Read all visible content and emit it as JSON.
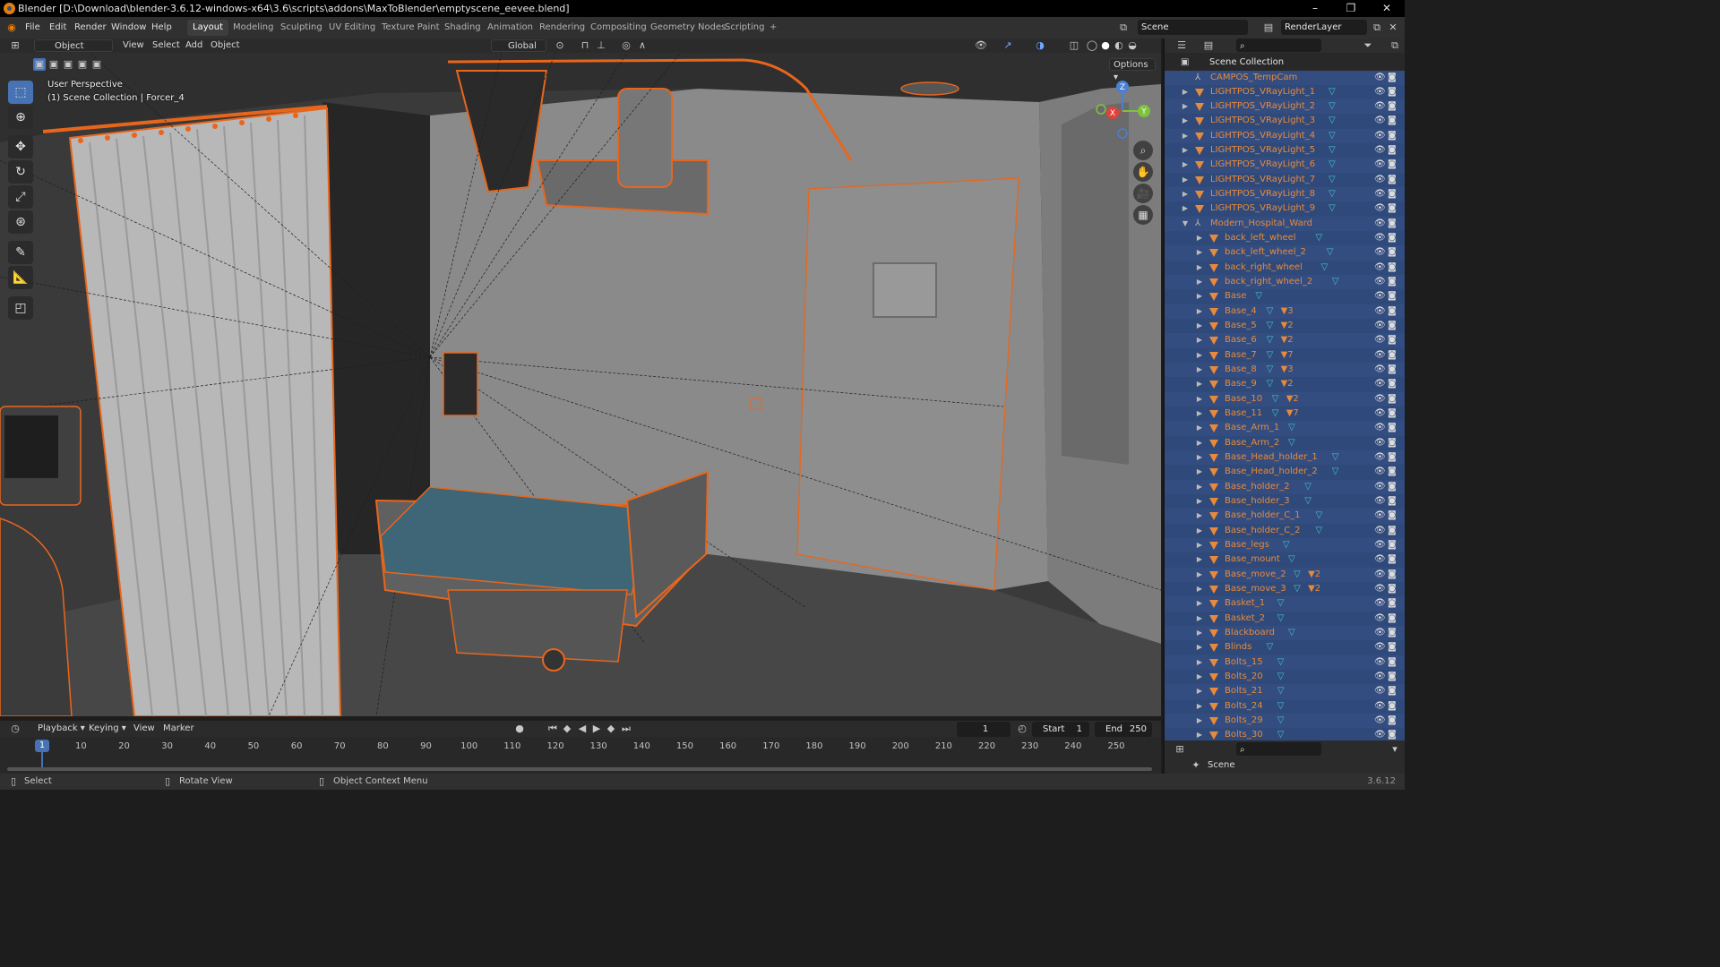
{
  "window": {
    "title": "Blender [D:\\Download\\blender-3.6.12-windows-x64\\3.6\\scripts\\addons\\MaxToBlender\\emptyscene_eevee.blend]",
    "controls": [
      "–",
      "❐",
      "✕"
    ]
  },
  "menubar": {
    "menus": [
      "File",
      "Edit",
      "Render",
      "Window",
      "Help"
    ],
    "workspaces": [
      "Layout",
      "Modeling",
      "Sculpting",
      "UV Editing",
      "Texture Paint",
      "Shading",
      "Animation",
      "Rendering",
      "Compositing",
      "Geometry Nodes",
      "Scripting"
    ],
    "active_workspace": "Layout",
    "add_tab": "+",
    "scene": "Scene",
    "view_layer": "RenderLayer"
  },
  "viewport_header": {
    "mode": "Object Mode",
    "menus": [
      "View",
      "Select",
      "Add",
      "Object"
    ],
    "transform_orientation": "Global",
    "options": "Options"
  },
  "viewport": {
    "perspective_label": "User Perspective",
    "context_label": "(1) Scene Collection | Forcer_4",
    "gizmo_axes": [
      "X",
      "Y",
      "Z"
    ]
  },
  "toolbar": {
    "tools": [
      "select-box",
      "cursor",
      "move",
      "rotate",
      "scale",
      "transform",
      "annotate",
      "measure",
      "add-cube"
    ]
  },
  "outliner": {
    "root": "Scene Collection",
    "items": [
      {
        "name": "CAMPOS_TempCam",
        "level": 0,
        "kind": "empty",
        "expand": false,
        "mesh": false,
        "mods": ""
      },
      {
        "name": "LIGHTPOS_VRayLight_1",
        "level": 0,
        "kind": "object",
        "expand": true,
        "mesh": true,
        "mods": ""
      },
      {
        "name": "LIGHTPOS_VRayLight_2",
        "level": 0,
        "kind": "object",
        "expand": true,
        "mesh": true,
        "mods": ""
      },
      {
        "name": "LIGHTPOS_VRayLight_3",
        "level": 0,
        "kind": "object",
        "expand": true,
        "mesh": true,
        "mods": ""
      },
      {
        "name": "LIGHTPOS_VRayLight_4",
        "level": 0,
        "kind": "object",
        "expand": true,
        "mesh": true,
        "mods": ""
      },
      {
        "name": "LIGHTPOS_VRayLight_5",
        "level": 0,
        "kind": "object",
        "expand": true,
        "mesh": true,
        "mods": ""
      },
      {
        "name": "LIGHTPOS_VRayLight_6",
        "level": 0,
        "kind": "object",
        "expand": true,
        "mesh": true,
        "mods": ""
      },
      {
        "name": "LIGHTPOS_VRayLight_7",
        "level": 0,
        "kind": "object",
        "expand": true,
        "mesh": true,
        "mods": ""
      },
      {
        "name": "LIGHTPOS_VRayLight_8",
        "level": 0,
        "kind": "object",
        "expand": true,
        "mesh": true,
        "mods": ""
      },
      {
        "name": "LIGHTPOS_VRayLight_9",
        "level": 0,
        "kind": "object",
        "expand": true,
        "mesh": true,
        "mods": ""
      },
      {
        "name": "Modern_Hospital_Ward",
        "level": 0,
        "kind": "empty",
        "expand": "open",
        "mesh": false,
        "mods": ""
      },
      {
        "name": "back_left_wheel",
        "level": 1,
        "kind": "object",
        "expand": true,
        "mesh": true,
        "mods": ""
      },
      {
        "name": "back_left_wheel_2",
        "level": 1,
        "kind": "object",
        "expand": true,
        "mesh": true,
        "mods": ""
      },
      {
        "name": "back_right_wheel",
        "level": 1,
        "kind": "object",
        "expand": true,
        "mesh": true,
        "mods": ""
      },
      {
        "name": "back_right_wheel_2",
        "level": 1,
        "kind": "object",
        "expand": true,
        "mesh": true,
        "mods": ""
      },
      {
        "name": "Base",
        "level": 1,
        "kind": "object",
        "expand": true,
        "mesh": true,
        "mods": ""
      },
      {
        "name": "Base_4",
        "level": 1,
        "kind": "object",
        "expand": true,
        "mesh": true,
        "mods": "3"
      },
      {
        "name": "Base_5",
        "level": 1,
        "kind": "object",
        "expand": true,
        "mesh": true,
        "mods": "2"
      },
      {
        "name": "Base_6",
        "level": 1,
        "kind": "object",
        "expand": true,
        "mesh": true,
        "mods": "2"
      },
      {
        "name": "Base_7",
        "level": 1,
        "kind": "object",
        "expand": true,
        "mesh": true,
        "mods": "7"
      },
      {
        "name": "Base_8",
        "level": 1,
        "kind": "object",
        "expand": true,
        "mesh": true,
        "mods": "3"
      },
      {
        "name": "Base_9",
        "level": 1,
        "kind": "object",
        "expand": true,
        "mesh": true,
        "mods": "2"
      },
      {
        "name": "Base_10",
        "level": 1,
        "kind": "object",
        "expand": true,
        "mesh": true,
        "mods": "2"
      },
      {
        "name": "Base_11",
        "level": 1,
        "kind": "object",
        "expand": true,
        "mesh": true,
        "mods": "7"
      },
      {
        "name": "Base_Arm_1",
        "level": 1,
        "kind": "object",
        "expand": true,
        "mesh": true,
        "mods": ""
      },
      {
        "name": "Base_Arm_2",
        "level": 1,
        "kind": "object",
        "expand": true,
        "mesh": true,
        "mods": ""
      },
      {
        "name": "Base_Head_holder_1",
        "level": 1,
        "kind": "object",
        "expand": true,
        "mesh": true,
        "mods": ""
      },
      {
        "name": "Base_Head_holder_2",
        "level": 1,
        "kind": "object",
        "expand": true,
        "mesh": true,
        "mods": ""
      },
      {
        "name": "Base_holder_2",
        "level": 1,
        "kind": "object",
        "expand": true,
        "mesh": true,
        "mods": ""
      },
      {
        "name": "Base_holder_3",
        "level": 1,
        "kind": "object",
        "expand": true,
        "mesh": true,
        "mods": ""
      },
      {
        "name": "Base_holder_C_1",
        "level": 1,
        "kind": "object",
        "expand": true,
        "mesh": true,
        "mods": ""
      },
      {
        "name": "Base_holder_C_2",
        "level": 1,
        "kind": "object",
        "expand": true,
        "mesh": true,
        "mods": ""
      },
      {
        "name": "Base_legs",
        "level": 1,
        "kind": "object",
        "expand": true,
        "mesh": true,
        "mods": ""
      },
      {
        "name": "Base_mount",
        "level": 1,
        "kind": "object",
        "expand": true,
        "mesh": true,
        "mods": ""
      },
      {
        "name": "Base_move_2",
        "level": 1,
        "kind": "object",
        "expand": true,
        "mesh": true,
        "mods": "2"
      },
      {
        "name": "Base_move_3",
        "level": 1,
        "kind": "object",
        "expand": true,
        "mesh": true,
        "mods": "2"
      },
      {
        "name": "Basket_1",
        "level": 1,
        "kind": "object",
        "expand": true,
        "mesh": true,
        "mods": ""
      },
      {
        "name": "Basket_2",
        "level": 1,
        "kind": "object",
        "expand": true,
        "mesh": true,
        "mods": ""
      },
      {
        "name": "Blackboard",
        "level": 1,
        "kind": "object",
        "expand": true,
        "mesh": true,
        "mods": ""
      },
      {
        "name": "Blinds",
        "level": 1,
        "kind": "object",
        "expand": true,
        "mesh": true,
        "mods": ""
      },
      {
        "name": "Bolts_15",
        "level": 1,
        "kind": "object",
        "expand": true,
        "mesh": true,
        "mods": ""
      },
      {
        "name": "Bolts_20",
        "level": 1,
        "kind": "object",
        "expand": true,
        "mesh": true,
        "mods": ""
      },
      {
        "name": "Bolts_21",
        "level": 1,
        "kind": "object",
        "expand": true,
        "mesh": true,
        "mods": ""
      },
      {
        "name": "Bolts_24",
        "level": 1,
        "kind": "object",
        "expand": true,
        "mesh": true,
        "mods": ""
      },
      {
        "name": "Bolts_29",
        "level": 1,
        "kind": "object",
        "expand": true,
        "mesh": true,
        "mods": ""
      },
      {
        "name": "Bolts_30",
        "level": 1,
        "kind": "object",
        "expand": true,
        "mesh": true,
        "mods": ""
      }
    ]
  },
  "timeline": {
    "menus": [
      "Playback",
      "Keying",
      "View",
      "Marker"
    ],
    "current_frame": "1",
    "start_label": "Start",
    "start": "1",
    "end_label": "End",
    "end": "250",
    "ticks": [
      "1",
      "10",
      "20",
      "30",
      "40",
      "50",
      "60",
      "70",
      "80",
      "90",
      "100",
      "110",
      "120",
      "130",
      "140",
      "150",
      "160",
      "170",
      "180",
      "190",
      "200",
      "210",
      "220",
      "230",
      "240",
      "250"
    ]
  },
  "properties": {
    "scene_label": "Scene"
  },
  "statusbar": {
    "hint1": "Select",
    "hint2": "Rotate View",
    "hint3": "Object Context Menu",
    "version": "3.6.12"
  },
  "colors": {
    "selection_outline": "#e8661c",
    "outliner_selected": "#334d80",
    "active_tool": "#4772b3",
    "frame_marker": "#4772b3",
    "mattress": "#3e6677"
  }
}
